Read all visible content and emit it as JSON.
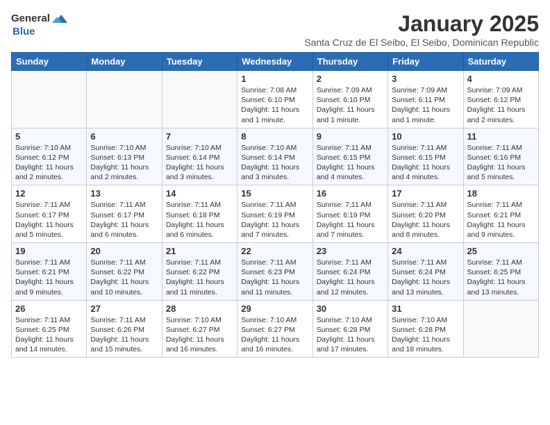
{
  "header": {
    "logo_general": "General",
    "logo_blue": "Blue",
    "month_title": "January 2025",
    "subtitle": "Santa Cruz de El Seibo, El Seibo, Dominican Republic"
  },
  "days_of_week": [
    "Sunday",
    "Monday",
    "Tuesday",
    "Wednesday",
    "Thursday",
    "Friday",
    "Saturday"
  ],
  "weeks": [
    [
      {
        "day": "",
        "text": ""
      },
      {
        "day": "",
        "text": ""
      },
      {
        "day": "",
        "text": ""
      },
      {
        "day": "1",
        "text": "Sunrise: 7:08 AM\nSunset: 6:10 PM\nDaylight: 11 hours and 1 minute."
      },
      {
        "day": "2",
        "text": "Sunrise: 7:09 AM\nSunset: 6:10 PM\nDaylight: 11 hours and 1 minute."
      },
      {
        "day": "3",
        "text": "Sunrise: 7:09 AM\nSunset: 6:11 PM\nDaylight: 11 hours and 1 minute."
      },
      {
        "day": "4",
        "text": "Sunrise: 7:09 AM\nSunset: 6:12 PM\nDaylight: 11 hours and 2 minutes."
      }
    ],
    [
      {
        "day": "5",
        "text": "Sunrise: 7:10 AM\nSunset: 6:12 PM\nDaylight: 11 hours and 2 minutes."
      },
      {
        "day": "6",
        "text": "Sunrise: 7:10 AM\nSunset: 6:13 PM\nDaylight: 11 hours and 2 minutes."
      },
      {
        "day": "7",
        "text": "Sunrise: 7:10 AM\nSunset: 6:14 PM\nDaylight: 11 hours and 3 minutes."
      },
      {
        "day": "8",
        "text": "Sunrise: 7:10 AM\nSunset: 6:14 PM\nDaylight: 11 hours and 3 minutes."
      },
      {
        "day": "9",
        "text": "Sunrise: 7:11 AM\nSunset: 6:15 PM\nDaylight: 11 hours and 4 minutes."
      },
      {
        "day": "10",
        "text": "Sunrise: 7:11 AM\nSunset: 6:15 PM\nDaylight: 11 hours and 4 minutes."
      },
      {
        "day": "11",
        "text": "Sunrise: 7:11 AM\nSunset: 6:16 PM\nDaylight: 11 hours and 5 minutes."
      }
    ],
    [
      {
        "day": "12",
        "text": "Sunrise: 7:11 AM\nSunset: 6:17 PM\nDaylight: 11 hours and 5 minutes."
      },
      {
        "day": "13",
        "text": "Sunrise: 7:11 AM\nSunset: 6:17 PM\nDaylight: 11 hours and 6 minutes."
      },
      {
        "day": "14",
        "text": "Sunrise: 7:11 AM\nSunset: 6:18 PM\nDaylight: 11 hours and 6 minutes."
      },
      {
        "day": "15",
        "text": "Sunrise: 7:11 AM\nSunset: 6:19 PM\nDaylight: 11 hours and 7 minutes."
      },
      {
        "day": "16",
        "text": "Sunrise: 7:11 AM\nSunset: 6:19 PM\nDaylight: 11 hours and 7 minutes."
      },
      {
        "day": "17",
        "text": "Sunrise: 7:11 AM\nSunset: 6:20 PM\nDaylight: 11 hours and 8 minutes."
      },
      {
        "day": "18",
        "text": "Sunrise: 7:11 AM\nSunset: 6:21 PM\nDaylight: 11 hours and 9 minutes."
      }
    ],
    [
      {
        "day": "19",
        "text": "Sunrise: 7:11 AM\nSunset: 6:21 PM\nDaylight: 11 hours and 9 minutes."
      },
      {
        "day": "20",
        "text": "Sunrise: 7:11 AM\nSunset: 6:22 PM\nDaylight: 11 hours and 10 minutes."
      },
      {
        "day": "21",
        "text": "Sunrise: 7:11 AM\nSunset: 6:22 PM\nDaylight: 11 hours and 11 minutes."
      },
      {
        "day": "22",
        "text": "Sunrise: 7:11 AM\nSunset: 6:23 PM\nDaylight: 11 hours and 11 minutes."
      },
      {
        "day": "23",
        "text": "Sunrise: 7:11 AM\nSunset: 6:24 PM\nDaylight: 11 hours and 12 minutes."
      },
      {
        "day": "24",
        "text": "Sunrise: 7:11 AM\nSunset: 6:24 PM\nDaylight: 11 hours and 13 minutes."
      },
      {
        "day": "25",
        "text": "Sunrise: 7:11 AM\nSunset: 6:25 PM\nDaylight: 11 hours and 13 minutes."
      }
    ],
    [
      {
        "day": "26",
        "text": "Sunrise: 7:11 AM\nSunset: 6:25 PM\nDaylight: 11 hours and 14 minutes."
      },
      {
        "day": "27",
        "text": "Sunrise: 7:11 AM\nSunset: 6:26 PM\nDaylight: 11 hours and 15 minutes."
      },
      {
        "day": "28",
        "text": "Sunrise: 7:10 AM\nSunset: 6:27 PM\nDaylight: 11 hours and 16 minutes."
      },
      {
        "day": "29",
        "text": "Sunrise: 7:10 AM\nSunset: 6:27 PM\nDaylight: 11 hours and 16 minutes."
      },
      {
        "day": "30",
        "text": "Sunrise: 7:10 AM\nSunset: 6:28 PM\nDaylight: 11 hours and 17 minutes."
      },
      {
        "day": "31",
        "text": "Sunrise: 7:10 AM\nSunset: 6:28 PM\nDaylight: 11 hours and 18 minutes."
      },
      {
        "day": "",
        "text": ""
      }
    ]
  ]
}
